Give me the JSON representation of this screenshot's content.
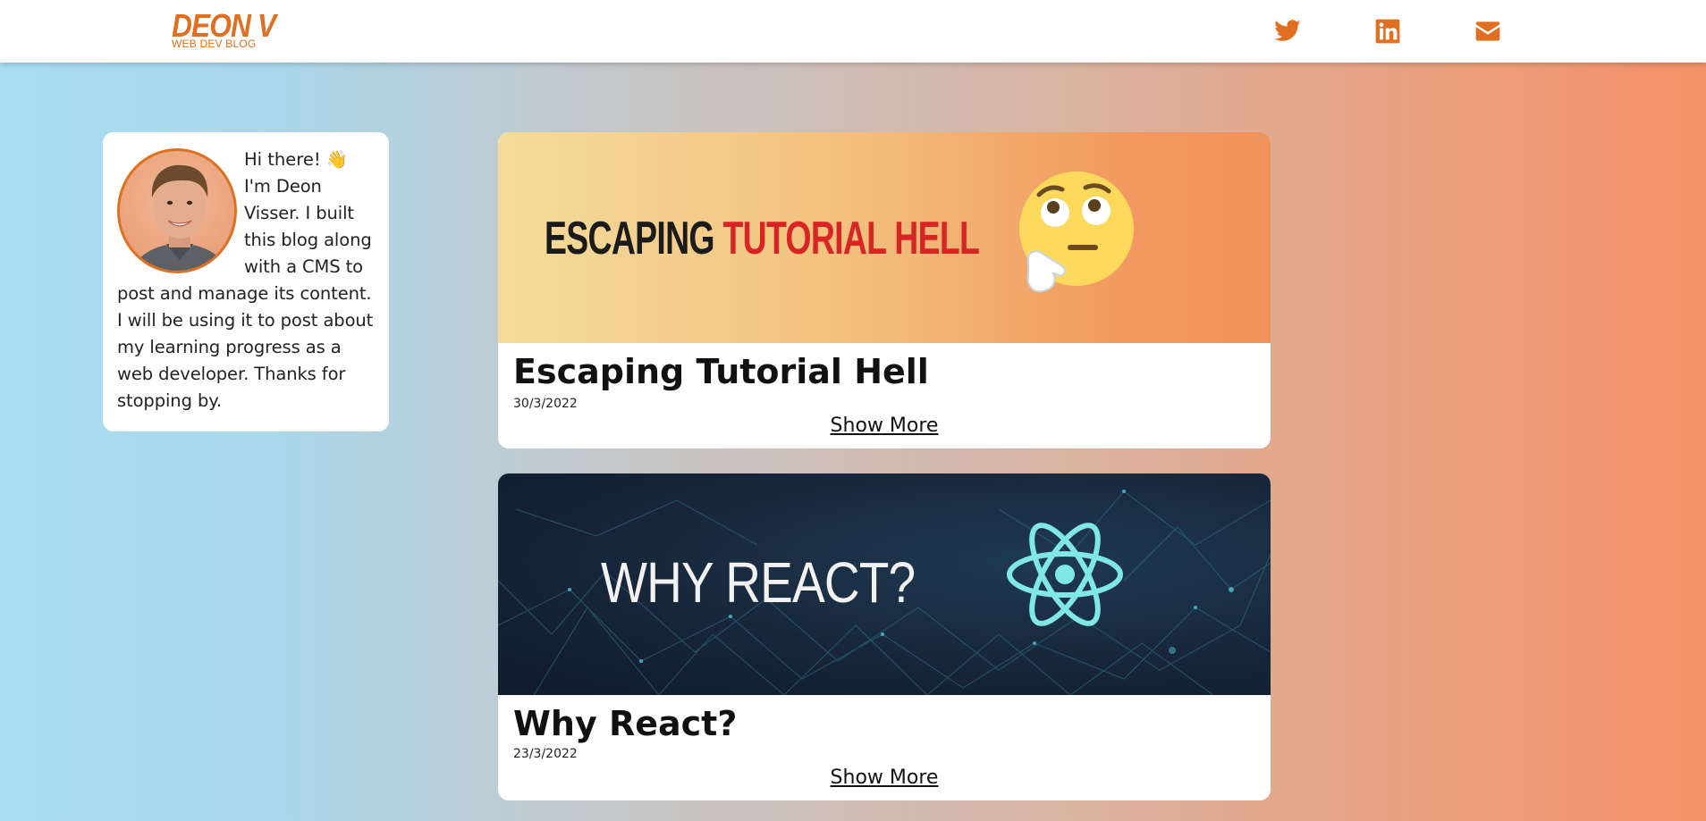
{
  "header": {
    "logo_title": "DEON V",
    "logo_subtitle": "WEB DEV BLOG",
    "social": [
      {
        "name": "twitter-icon"
      },
      {
        "name": "linkedin-icon"
      },
      {
        "name": "email-icon"
      }
    ]
  },
  "about": {
    "greeting": "Hi there! 👋",
    "text": "I'm Deon Visser. I built this blog along with a CMS to post and manage its content. I will be using it to post about my learning progress as a web developer. Thanks for stopping by."
  },
  "posts": [
    {
      "image_text_a": "ESCAPING",
      "image_text_b": "TUTORIAL HELL",
      "title": "Escaping Tutorial Hell",
      "date": "30/3/2022",
      "show_more": "Show More"
    },
    {
      "image_text": "WHY REACT?",
      "title": "Why React?",
      "date": "23/3/2022",
      "show_more": "Show More"
    }
  ],
  "colors": {
    "accent": "#e0701f",
    "card_bg": "#ffffff",
    "tutorial_hell_red": "#d92424",
    "react_cyan": "#7fe8e4"
  }
}
